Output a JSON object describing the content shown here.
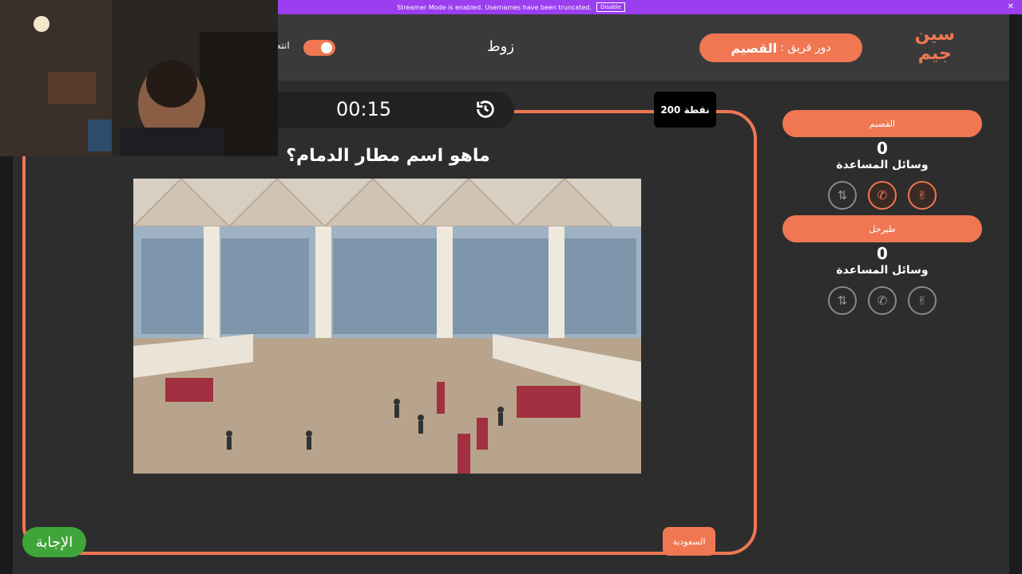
{
  "banner": {
    "message": "Streamer Mode is enabled. Usernames have been truncated.",
    "disable_label": "Disable",
    "close_glyph": "✕"
  },
  "header": {
    "logo_line1": "سين",
    "logo_line2": "جيم",
    "turn_label": "دور فريق :",
    "turn_team": "القصيم",
    "opponent_name": "زوط",
    "end_label": "انته"
  },
  "game": {
    "timer": "00:15",
    "reset_icon": "history-icon",
    "points": "200 نقطة",
    "question": "ماهو اسم مطار الدمام؟",
    "answer_label": "الإجابة",
    "country_tag": "السعودية"
  },
  "teams": [
    {
      "name": "القصيم",
      "score": "0",
      "aids_label": "وسائل المساعدة",
      "aids": [
        {
          "icon": "swap-icon",
          "active": false
        },
        {
          "icon": "phone-icon",
          "active": true
        },
        {
          "icon": "peace-hand-icon",
          "active": true
        }
      ]
    },
    {
      "name": "طيرجل",
      "score": "0",
      "aids_label": "وسائل المساعدة",
      "aids": [
        {
          "icon": "swap-icon",
          "active": false
        },
        {
          "icon": "phone-icon",
          "active": false
        },
        {
          "icon": "peace-hand-icon",
          "active": false
        }
      ]
    }
  ],
  "colors": {
    "accent": "#f07752",
    "answer_green": "#3fa53a",
    "banner_purple": "#9a3ef0"
  }
}
